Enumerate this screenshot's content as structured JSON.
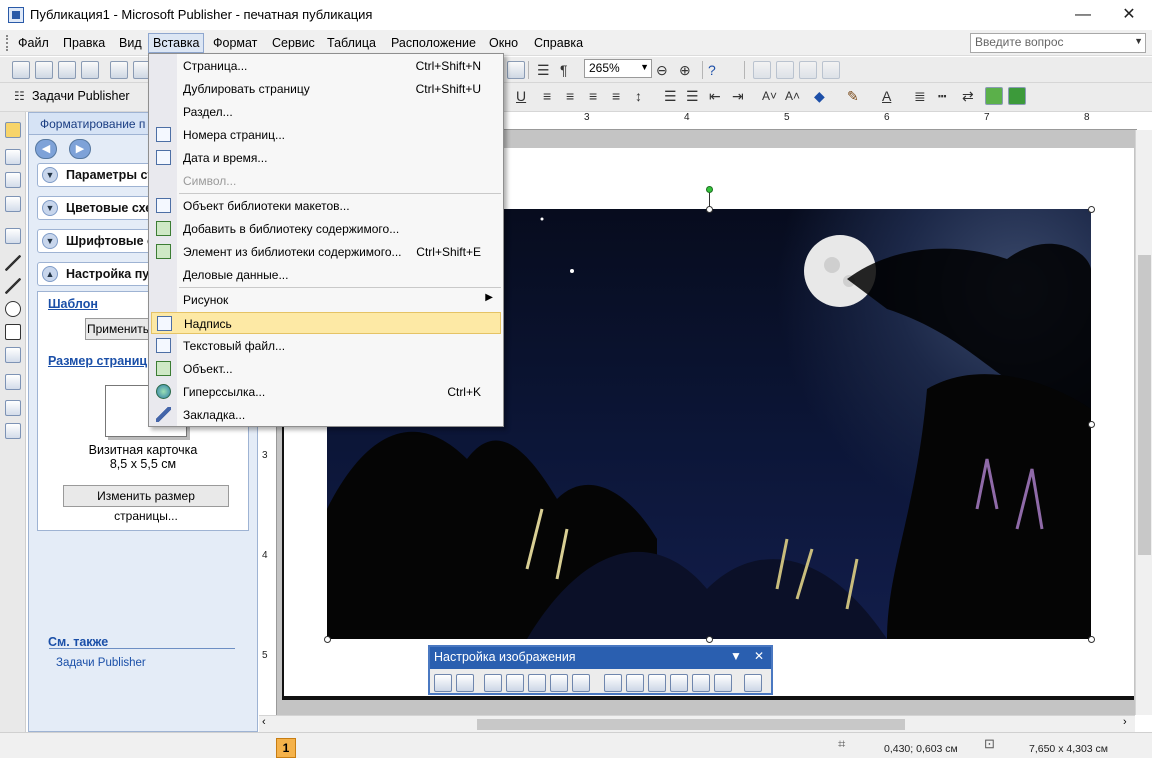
{
  "window": {
    "title": "Публикация1 - Microsoft Publisher - печатная публикация",
    "controls": {
      "minimize": "—",
      "maximize": "☐",
      "close": "✕"
    }
  },
  "menubar": {
    "items": [
      {
        "label": "Файл"
      },
      {
        "label": "Правка"
      },
      {
        "label": "Вид"
      },
      {
        "label": "Вставка",
        "active": true
      },
      {
        "label": "Формат"
      },
      {
        "label": "Сервис"
      },
      {
        "label": "Таблица"
      },
      {
        "label": "Расположение"
      },
      {
        "label": "Окно"
      },
      {
        "label": "Справка"
      }
    ],
    "help_placeholder": "Введите вопрос"
  },
  "toolbar": {
    "zoom": "265%",
    "tasks_label": "Задачи Publisher"
  },
  "taskpane": {
    "title": "Форматирование п",
    "sections": [
      "Параметры ст",
      "Цветовые схе",
      "Шрифтовые с",
      "Настройка публ"
    ],
    "template_link": "Шаблон",
    "apply_button": "Применить",
    "page_size_link": "Размер страницы",
    "page_name": "Визитная карточка",
    "page_dims": "8,5 x 5,5 см",
    "change_size_button": "Изменить размер страницы...",
    "see_also": "См. также",
    "tasks_link": "Задачи Publisher"
  },
  "rulers": {
    "h_labels": [
      "3",
      "4",
      "5",
      "6",
      "7",
      "8"
    ],
    "v_labels": [
      "3",
      "4",
      "5"
    ]
  },
  "insert_menu": {
    "items": [
      {
        "label": "Страница...",
        "shortcut": "Ctrl+Shift+N",
        "icon": "none"
      },
      {
        "label": "Дублировать страницу",
        "shortcut": "Ctrl+Shift+U",
        "icon": "none"
      },
      {
        "label": "Раздел...",
        "shortcut": "",
        "icon": "none"
      },
      {
        "label": "Номера страниц...",
        "shortcut": "",
        "icon": "page-number-icon"
      },
      {
        "label": "Дата и время...",
        "shortcut": "",
        "icon": "date-time-icon"
      },
      {
        "label": "Символ...",
        "shortcut": "",
        "icon": "none",
        "disabled": true
      },
      {
        "label": "Объект библиотеки макетов...",
        "shortcut": "",
        "icon": "design-gallery-icon"
      },
      {
        "label": "Добавить в библиотеку содержимого...",
        "shortcut": "",
        "icon": "add-to-library-icon"
      },
      {
        "label": "Элемент из библиотеки содержимого...",
        "shortcut": "Ctrl+Shift+E",
        "icon": "library-item-icon"
      },
      {
        "label": "Деловые данные...",
        "shortcut": "",
        "icon": "none"
      },
      {
        "label": "Рисунок",
        "shortcut": "",
        "icon": "none",
        "submenu": true
      },
      {
        "label": "Надпись",
        "shortcut": "",
        "icon": "text-box-icon",
        "highlight": true
      },
      {
        "label": "Текстовый файл...",
        "shortcut": "",
        "icon": "text-file-icon"
      },
      {
        "label": "Объект...",
        "shortcut": "",
        "icon": "object-icon"
      },
      {
        "label": "Гиперссылка...",
        "shortcut": "Ctrl+K",
        "icon": "hyperlink-icon"
      },
      {
        "label": "Закладка...",
        "shortcut": "",
        "icon": "bookmark-icon"
      }
    ]
  },
  "picture_toolbar": {
    "title": "Настройка изображения"
  },
  "statusbar": {
    "page_number": "1",
    "position": "0,430; 0,603 см",
    "size": "7,650 x 4,303 см"
  },
  "colors": {
    "accent": "#2a5fb0",
    "menu_highlight": "#fde9a5",
    "taskpane_bg": "#e4ecf7",
    "page_badge": "#f5b24a"
  }
}
